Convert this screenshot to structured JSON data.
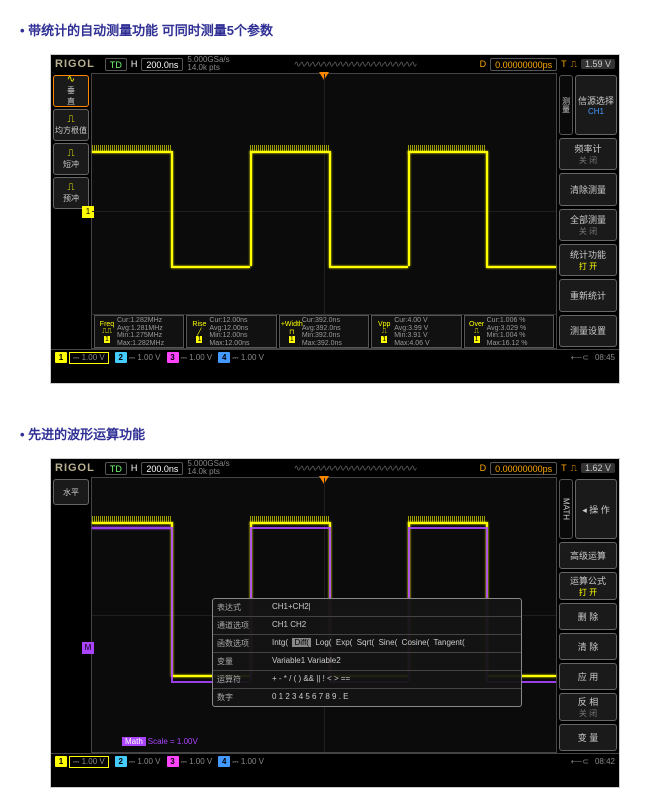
{
  "section1_title": "带统计的自动测量功能  可同时测量5个参数",
  "section2_title": "先进的波形运算功能",
  "scope1": {
    "logo": "RIGOL",
    "td": "TD",
    "H": "H",
    "timebase": "200.0ns",
    "sa1": "5.000GSa/s",
    "sa2": "14.0k pts",
    "D": "D",
    "dval": "0.00000000ps",
    "T": "T",
    "trig_volt": "1.59 V",
    "left_tabs": [
      {
        "line1": "垂",
        "line2": "直"
      },
      {
        "label": "均方根值"
      },
      {
        "label": "短冲"
      },
      {
        "label": "预冲"
      }
    ],
    "right_tab": "测量",
    "right_buttons": [
      {
        "label": "信源选择",
        "sub": "CH1",
        "cls": "sub"
      },
      {
        "label": "频率计",
        "sub": "关 闭",
        "cls": "subg"
      },
      {
        "label": "清除测量",
        "sub": "",
        "cls": ""
      },
      {
        "label": "全部测量",
        "sub": "关 闭",
        "cls": "subg"
      },
      {
        "label": "统计功能",
        "sub": "打 开",
        "cls": "suby"
      },
      {
        "label": "重新统计",
        "sub": "",
        "cls": ""
      },
      {
        "label": "测量设置",
        "sub": "",
        "cls": ""
      }
    ],
    "measurements": [
      {
        "name": "Freq",
        "lines": [
          "Cur:1.282MHz",
          "Avg:1.281MHz",
          "Min:1.275MHz",
          "Max:1.282MHz"
        ]
      },
      {
        "name": "Rise",
        "lines": [
          "Cur:12.00ns",
          "Avg:12.00ns",
          "Min:12.00ns",
          "Max:12.00ns"
        ]
      },
      {
        "name": "+Width",
        "lines": [
          "Cur:392.0ns",
          "Avg:392.0ns",
          "Min:392.0ns",
          "Max:392.0ns"
        ]
      },
      {
        "name": "Vpp",
        "lines": [
          "Cur:4.00 V",
          "Avg:3.99 V",
          "Min:3.91 V",
          "Max:4.06 V"
        ]
      },
      {
        "name": "Over",
        "lines": [
          "Cur:1.006 %",
          "Avg:3.029 %",
          "Min:1.004 %",
          "Max:16.12 %"
        ]
      }
    ],
    "channels": [
      {
        "n": "1",
        "v": "1.00 V",
        "cls": "y",
        "active": true
      },
      {
        "n": "2",
        "v": "1.00 V",
        "cls": "c",
        "active": false
      },
      {
        "n": "3",
        "v": "1.00 V",
        "cls": "m",
        "active": false
      },
      {
        "n": "4",
        "v": "1.00 V",
        "cls": "b",
        "active": false
      }
    ],
    "time": "08:45",
    "usb": "⟵⊂"
  },
  "scope2": {
    "logo": "RIGOL",
    "td": "TD",
    "H": "H",
    "timebase": "200.0ns",
    "sa1": "5.000GSa/s",
    "sa2": "14.0k pts",
    "D": "D",
    "dval": "0.00000000ps",
    "T": "T",
    "trig_volt": "1.62 V",
    "left_label": "水平",
    "right_tab": "MATH",
    "right_buttons": [
      {
        "label": "操 作",
        "arrow": "◂",
        "sub": "",
        "cls": ""
      },
      {
        "label": "高级运算",
        "sub": "",
        "cls": ""
      },
      {
        "label": "运算公式",
        "sub": "打 开",
        "cls": "suby"
      },
      {
        "label": "删 除",
        "sub": "",
        "cls": ""
      },
      {
        "label": "清 除",
        "sub": "",
        "cls": ""
      },
      {
        "label": "应 用",
        "sub": "",
        "cls": ""
      },
      {
        "label": "反 相",
        "sub": "关 闭",
        "cls": "subg"
      },
      {
        "label": "变 量",
        "sub": "",
        "cls": ""
      }
    ],
    "dialog": [
      {
        "k": "表达式",
        "v": "CH1+CH2|"
      },
      {
        "k": "通道选项",
        "v": "CH1 CH2"
      },
      {
        "k": "函数选项",
        "v": "Intg(  Diff(  Log(  Exp(  Sqrt(  Sine(  Cosine(  Tangent("
      },
      {
        "k": "变量",
        "v": "Variable1   Variable2"
      },
      {
        "k": "运算符",
        "v": "+  -  *  /  (  )           &&  ||  !  <  >  =="
      },
      {
        "k": "数字",
        "v": "0  1  2  3  4  5  6  7  8  9     .     E"
      }
    ],
    "math_label": "Math",
    "math_scale": "Scale = 1.00V",
    "channels": [
      {
        "n": "1",
        "v": "1.00 V",
        "cls": "y",
        "active": true
      },
      {
        "n": "2",
        "v": "1.00 V",
        "cls": "c",
        "active": false
      },
      {
        "n": "3",
        "v": "1.00 V",
        "cls": "m",
        "active": false
      },
      {
        "n": "4",
        "v": "1.00 V",
        "cls": "b",
        "active": false
      }
    ],
    "time": "08:42",
    "usb": "⟵⊂"
  }
}
